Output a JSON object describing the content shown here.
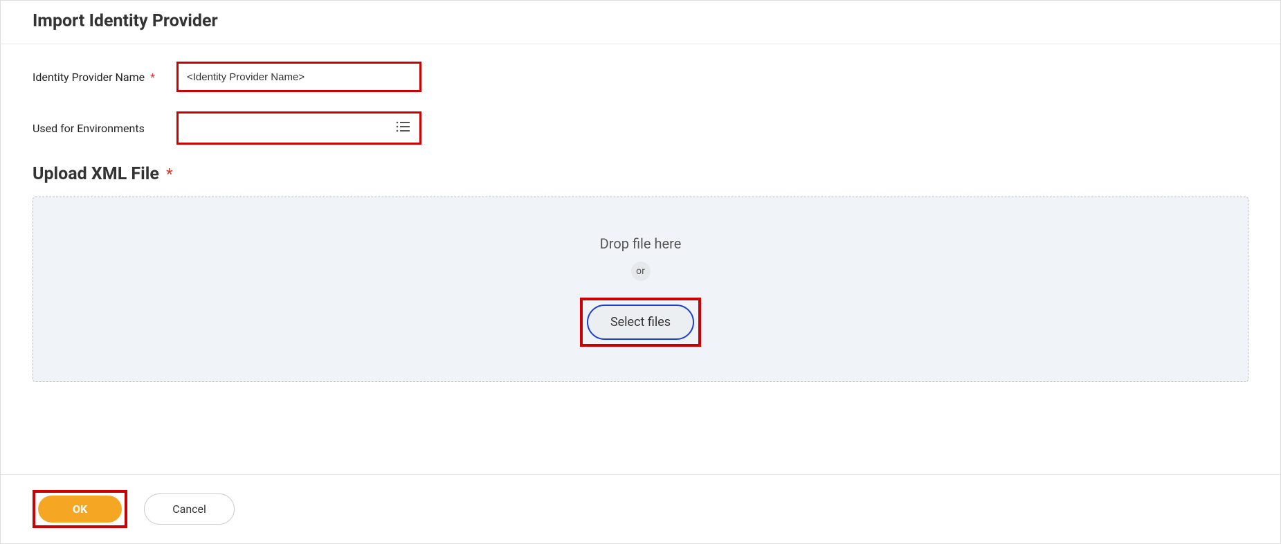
{
  "header": {
    "title": "Import Identity Provider"
  },
  "form": {
    "name_label": "Identity Provider Name",
    "name_value": "<Identity Provider Name>",
    "environments_label": "Used for Environments"
  },
  "upload": {
    "title": "Upload XML File",
    "drop_text": "Drop file here",
    "or_text": "or",
    "select_files_label": "Select files"
  },
  "footer": {
    "ok_label": "OK",
    "cancel_label": "Cancel"
  }
}
